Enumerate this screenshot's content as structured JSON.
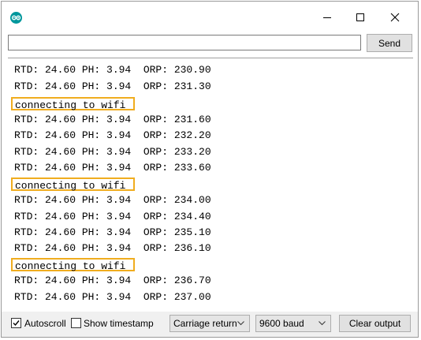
{
  "window": {
    "min_icon": "minimize-icon",
    "max_icon": "maximize-icon",
    "close_icon": "close-icon",
    "app_icon": "arduino-logo-icon",
    "brand_color": "#00979c"
  },
  "send": {
    "input_value": "",
    "button_label": "Send"
  },
  "output": {
    "highlight_color": "#f0ad1f",
    "lines": [
      "RTD: 24.60 PH: 3.94  ORP: 230.90",
      "RTD: 24.60 PH: 3.94  ORP: 231.30",
      "connecting to wifi",
      "RTD: 24.60 PH: 3.94  ORP: 231.60",
      "RTD: 24.60 PH: 3.94  ORP: 232.20",
      "RTD: 24.60 PH: 3.94  ORP: 233.20",
      "RTD: 24.60 PH: 3.94  ORP: 233.60",
      "connecting to wifi",
      "RTD: 24.60 PH: 3.94  ORP: 234.00",
      "RTD: 24.60 PH: 3.94  ORP: 234.40",
      "RTD: 24.60 PH: 3.94  ORP: 235.10",
      "RTD: 24.60 PH: 3.94  ORP: 236.10",
      "connecting to wifi",
      "RTD: 24.60 PH: 3.94  ORP: 236.70",
      "RTD: 24.60 PH: 3.94  ORP: 237.00"
    ]
  },
  "bottom": {
    "autoscroll_label": "Autoscroll",
    "autoscroll_checked": true,
    "timestamp_label": "Show timestamp",
    "timestamp_checked": false,
    "line_ending": "Carriage return",
    "baud": "9600 baud",
    "clear_label": "Clear output"
  }
}
